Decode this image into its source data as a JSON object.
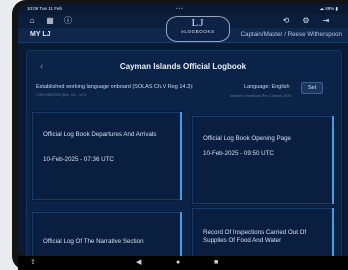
{
  "status": {
    "time": "10:06  Tue 11 Feb",
    "dots": "•••",
    "right": "☁ 89% ▮"
  },
  "topnav": {
    "left_icons": [
      "home-icon",
      "grid-icon",
      "info-icon"
    ],
    "right_icons": [
      "sync-icon",
      "gear-icon",
      "logout-icon"
    ]
  },
  "logo": {
    "mark": "LJ",
    "sub": "eLOGBOOKS"
  },
  "header": {
    "left": "MY LJ",
    "right": "Captain/Master / Reese Witherspoon"
  },
  "page": {
    "title": "Cayman Islands Official Logbook",
    "language_label": "Established working language onboard (SOLAS Ch.V Reg 14.3):",
    "language_note": "CISH 080/2025 (Rev. 01) - v3.0",
    "language_value": "Language: English",
    "set_label": "Set",
    "handbook_note": "Master's Handbook Rev 3 March 2020"
  },
  "cards": [
    {
      "title": "Official Log Book Departures And Arrivals",
      "date": "10-Feb-2025 - 07:36 UTC"
    },
    {
      "title": "Official Log Book Opening Page",
      "date": "10-Feb-2025 - 09:50 UTC"
    },
    {
      "title": "Official Log Of The Narrative Section",
      "date": ""
    },
    {
      "title": "Record Of Inspections Carried Out Of Supplies Of Food And Water",
      "date": ""
    }
  ],
  "accent": "#3f9cf0"
}
